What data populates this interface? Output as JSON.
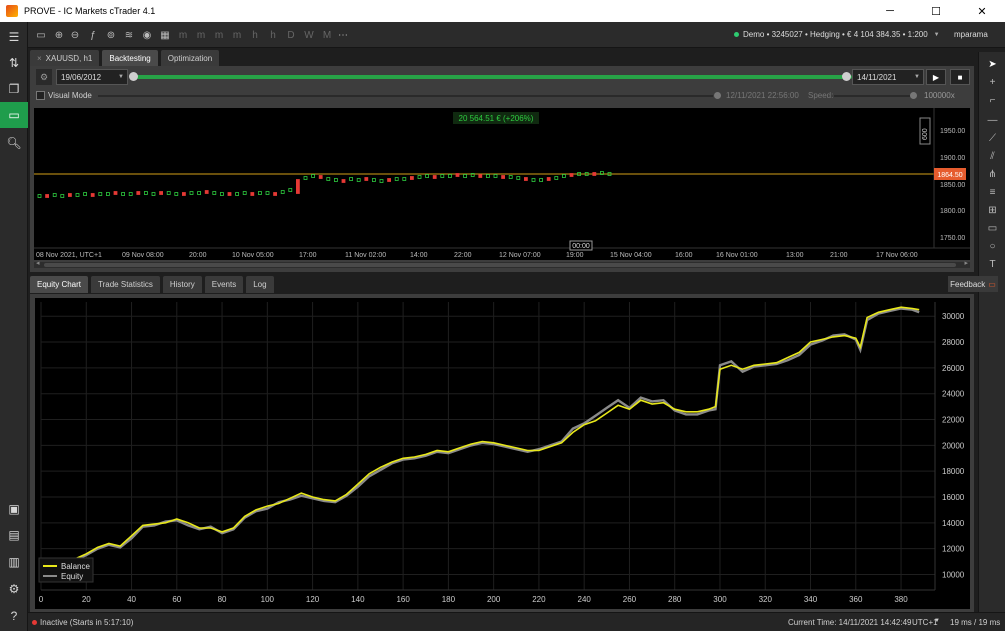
{
  "window": {
    "title": "PROVE - IC Markets cTrader 4.1",
    "minimize": "─",
    "maximize": "☐",
    "close": "✕"
  },
  "account": {
    "text": "Demo • 3245027 • Hedging • € 4 104 384.35 • 1:200",
    "user": "mparama"
  },
  "tabs_top": [
    {
      "label": "XAUUSD, h1"
    },
    {
      "label": "Backtesting"
    },
    {
      "label": "Optimization"
    }
  ],
  "backtest": {
    "start_date": "19/06/2012",
    "end_date": "14/11/2021",
    "visual_mode_label": "Visual Mode",
    "visual_date": "12/11/2021 22:56:00",
    "speed_label": "Speed:",
    "speed_value": "100000x",
    "play_glyph": "▶",
    "stop_glyph": "■"
  },
  "price_chart": {
    "profit_label": "20 564.51 € (+206%)",
    "current_price": "1864.50",
    "time_marker": "00:00",
    "scale_label": "600",
    "y_ticks": [
      "1950.00",
      "1900.00",
      "1850.00",
      "1800.00",
      "1750.00"
    ],
    "x_ticks": [
      "08 Nov 2021, UTC+1",
      "09 Nov 08:00",
      "20:00",
      "10 Nov 05:00",
      "17:00",
      "11 Nov 02:00",
      "14:00",
      "22:00",
      "12 Nov 07:00",
      "19:00",
      "15 Nov 04:00",
      "16:00",
      "16 Nov 01:00",
      "13:00",
      "21:00",
      "17 Nov 06:00"
    ],
    "colors": {
      "up": "#2ecc40",
      "down": "#e53935",
      "price_line": "#d4a017",
      "price_badge": "#e65c2e"
    }
  },
  "tabs_bottom": [
    {
      "label": "Equity Chart"
    },
    {
      "label": "Trade Statistics"
    },
    {
      "label": "History"
    },
    {
      "label": "Events"
    },
    {
      "label": "Log"
    }
  ],
  "feedback_label": "Feedback",
  "chart_data": {
    "type": "line",
    "xlim": [
      0,
      395
    ],
    "ylim": [
      8800,
      31100
    ],
    "x_ticks": [
      0,
      20,
      40,
      60,
      80,
      100,
      120,
      140,
      160,
      180,
      200,
      220,
      240,
      260,
      280,
      300,
      320,
      340,
      360,
      380
    ],
    "y_ticks": [
      10000,
      12000,
      14000,
      16000,
      18000,
      20000,
      22000,
      24000,
      26000,
      28000,
      30000
    ],
    "grid": true,
    "legend_position": "bottom-left",
    "series": [
      {
        "name": "Balance",
        "color": "#e8e81a",
        "x": [
          0,
          5,
          10,
          15,
          20,
          25,
          30,
          35,
          40,
          45,
          50,
          55,
          60,
          65,
          70,
          75,
          80,
          85,
          90,
          95,
          100,
          105,
          110,
          115,
          120,
          125,
          130,
          135,
          140,
          145,
          150,
          155,
          160,
          165,
          170,
          175,
          180,
          185,
          190,
          195,
          200,
          205,
          210,
          215,
          220,
          225,
          230,
          235,
          240,
          245,
          250,
          255,
          260,
          265,
          270,
          275,
          280,
          285,
          290,
          295,
          298,
          300,
          305,
          310,
          315,
          320,
          325,
          330,
          335,
          340,
          345,
          350,
          355,
          360,
          362,
          365,
          370,
          375,
          380,
          385,
          388
        ],
        "values": [
          10500,
          10700,
          10900,
          11200,
          11600,
          12100,
          12400,
          12200,
          13000,
          13800,
          13900,
          14000,
          14300,
          14000,
          13600,
          13600,
          13300,
          13600,
          14500,
          15000,
          15300,
          15500,
          15900,
          16300,
          16000,
          15800,
          15700,
          16200,
          17000,
          17800,
          18300,
          18700,
          19000,
          19100,
          19300,
          19600,
          19500,
          19800,
          20100,
          20300,
          20200,
          20000,
          19800,
          19600,
          19600,
          19900,
          20200,
          21000,
          21600,
          21900,
          22500,
          23100,
          22800,
          23500,
          23200,
          23300,
          22800,
          22600,
          22600,
          22800,
          23000,
          25900,
          26200,
          25900,
          26200,
          26300,
          26400,
          26800,
          27200,
          28000,
          28200,
          28400,
          28500,
          28300,
          27600,
          29900,
          30300,
          30500,
          30700,
          30600,
          30500
        ]
      },
      {
        "name": "Equity",
        "color": "#8a8a8a",
        "x": [
          0,
          5,
          10,
          15,
          20,
          25,
          30,
          35,
          40,
          45,
          50,
          55,
          60,
          65,
          70,
          75,
          80,
          85,
          90,
          95,
          100,
          105,
          110,
          115,
          120,
          125,
          130,
          135,
          140,
          145,
          150,
          155,
          160,
          165,
          170,
          175,
          180,
          185,
          190,
          195,
          200,
          205,
          210,
          215,
          220,
          225,
          230,
          235,
          240,
          245,
          250,
          255,
          260,
          265,
          270,
          275,
          280,
          285,
          290,
          295,
          298,
          300,
          305,
          310,
          315,
          320,
          325,
          330,
          335,
          340,
          345,
          350,
          355,
          360,
          362,
          365,
          370,
          375,
          380,
          385,
          388
        ],
        "values": [
          10300,
          10600,
          11000,
          11100,
          11500,
          12000,
          12300,
          12100,
          12800,
          13700,
          13800,
          14100,
          14200,
          13800,
          13500,
          13700,
          13200,
          13500,
          14400,
          14900,
          15100,
          15600,
          15800,
          16100,
          15900,
          15700,
          15600,
          16100,
          16800,
          17600,
          18100,
          18600,
          18900,
          19000,
          19200,
          19500,
          19400,
          19700,
          20000,
          20200,
          20100,
          19900,
          19700,
          19500,
          19700,
          20000,
          20300,
          21300,
          21700,
          22300,
          22900,
          23500,
          22900,
          23700,
          23400,
          23500,
          22700,
          22400,
          22400,
          22700,
          22800,
          26200,
          26500,
          25700,
          26100,
          26200,
          26300,
          26600,
          27000,
          27800,
          28100,
          28500,
          28600,
          28200,
          27400,
          29700,
          30200,
          30400,
          30600,
          30500,
          30300
        ]
      }
    ]
  },
  "status": {
    "state": "Inactive (Starts in 5:17:10)",
    "current_time": "Current Time:  14/11/2021 14:42:49",
    "timezone": "UTC+1",
    "latency": "19 ms / 19 ms"
  }
}
